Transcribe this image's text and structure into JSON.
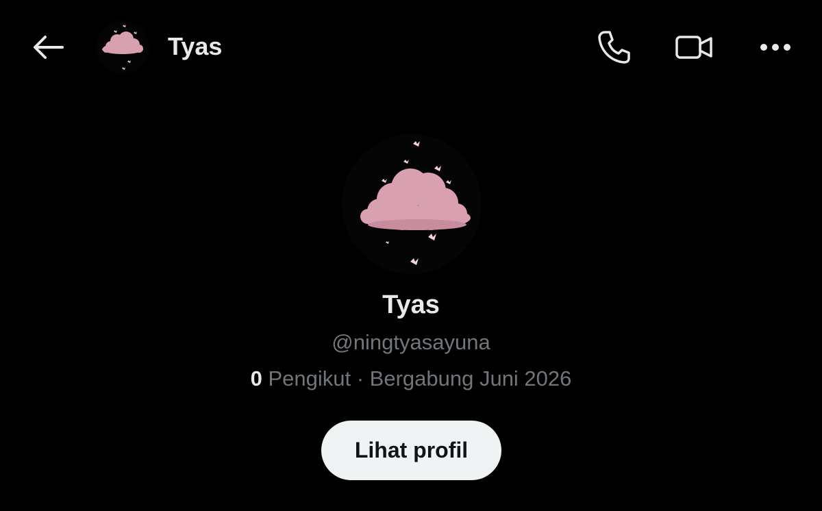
{
  "header": {
    "title": "Tyas",
    "back_icon": "arrow-left-icon",
    "call_icon": "phone-icon",
    "video_icon": "video-camera-icon",
    "more_icon": "more-horizontal-icon",
    "avatar_image": "pink-cloud-butterflies-avatar"
  },
  "profile": {
    "avatar_image": "pink-cloud-butterflies-avatar",
    "name": "Tyas",
    "handle": "@ningtyasayuna",
    "followers_count": "0",
    "followers_label": " Pengikut",
    "separator": " · ",
    "joined": "Bergabung Juni 2026",
    "view_profile_label": "Lihat profil"
  },
  "colors": {
    "background": "#000000",
    "primary_text": "#e7e9ea",
    "secondary_text": "#71767b",
    "button_bg": "#eff3f4",
    "button_text": "#0f1419",
    "cloud_pink": "#d9a0b0"
  }
}
